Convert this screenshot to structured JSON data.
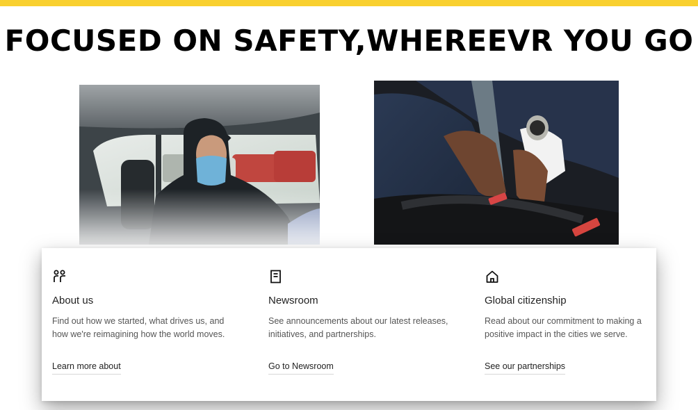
{
  "page": {
    "headline": "FOCUSED ON SAFETY,WHEREEVR YOU GO",
    "accent_color": "#f9d02f"
  },
  "images": {
    "left": {
      "icon": "masked-driver-photo"
    },
    "right": {
      "icon": "seatbelt-photo"
    }
  },
  "cards": [
    {
      "icon": "people-icon",
      "title": "About us",
      "description": "Find out how we started, what drives us, and how we're reimagining how the world moves.",
      "link": "Learn more about"
    },
    {
      "icon": "document-icon",
      "title": "Newsroom",
      "description": "See announcements about our latest releases, initiatives, and partnerships.",
      "link": "Go to Newsroom"
    },
    {
      "icon": "home-icon",
      "title": "Global citizenship",
      "description": "Read about our commitment to making a positive impact in the cities we serve.",
      "link": "See our partnerships"
    }
  ]
}
